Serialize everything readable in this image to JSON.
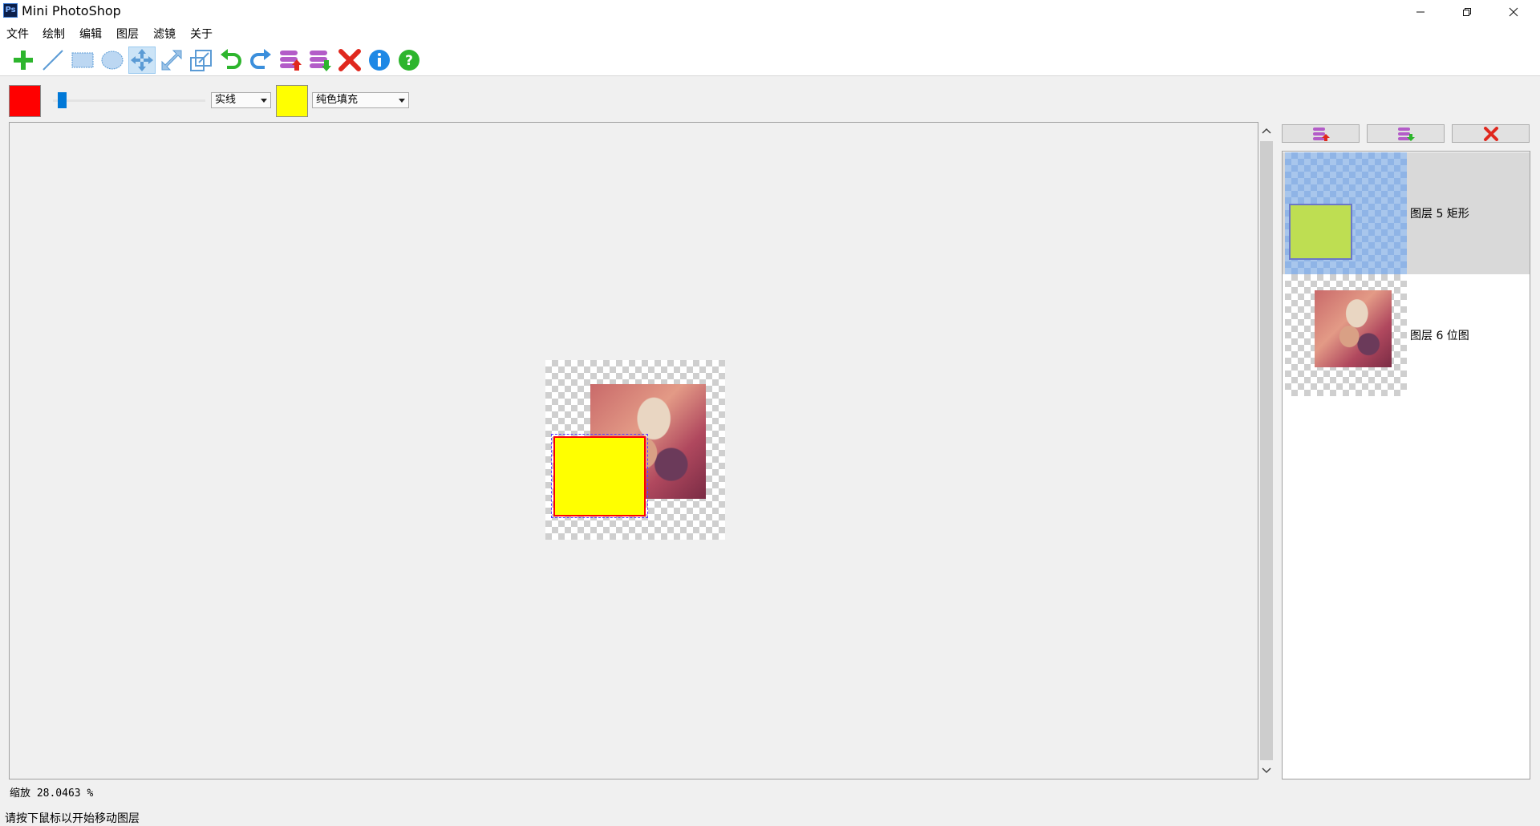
{
  "window": {
    "title": "Mini PhotoShop",
    "app_icon_text": "Ps",
    "controls": [
      "minimize-icon",
      "restore-icon",
      "close-icon"
    ]
  },
  "menu": [
    "文件",
    "绘制",
    "编辑",
    "图层",
    "滤镜",
    "关于"
  ],
  "toolbar": {
    "tools": [
      {
        "name": "add-icon"
      },
      {
        "name": "line-tool-icon"
      },
      {
        "name": "rectangle-tool-icon"
      },
      {
        "name": "ellipse-tool-icon"
      },
      {
        "name": "move-tool-icon",
        "active": true
      },
      {
        "name": "rotate-tool-icon"
      },
      {
        "name": "scale-tool-icon"
      },
      {
        "name": "undo-icon"
      },
      {
        "name": "redo-icon"
      },
      {
        "name": "layer-up-icon"
      },
      {
        "name": "layer-down-icon"
      },
      {
        "name": "delete-icon"
      },
      {
        "name": "info-icon"
      },
      {
        "name": "help-icon"
      }
    ]
  },
  "options": {
    "stroke_color": "#ff0000",
    "fill_color": "#ffff00",
    "line_style": "实线",
    "fill_style": "纯色填充",
    "brush_size_fraction": 0.03
  },
  "layers": [
    {
      "label": "图层 5 矩形",
      "selected": true
    },
    {
      "label": "图层 6 位图",
      "selected": false
    }
  ],
  "layer_panel_buttons": [
    "layer-up-icon",
    "layer-down-icon",
    "delete-icon"
  ],
  "status": {
    "zoom": "缩放 28.0463 %",
    "message": "请按下鼠标以开始移动图层"
  },
  "colors": {
    "accent": "#0078d7",
    "selection_bg": "#d9d9d9",
    "rect_fill": "#ffff00",
    "rect_stroke": "#ff0000"
  }
}
